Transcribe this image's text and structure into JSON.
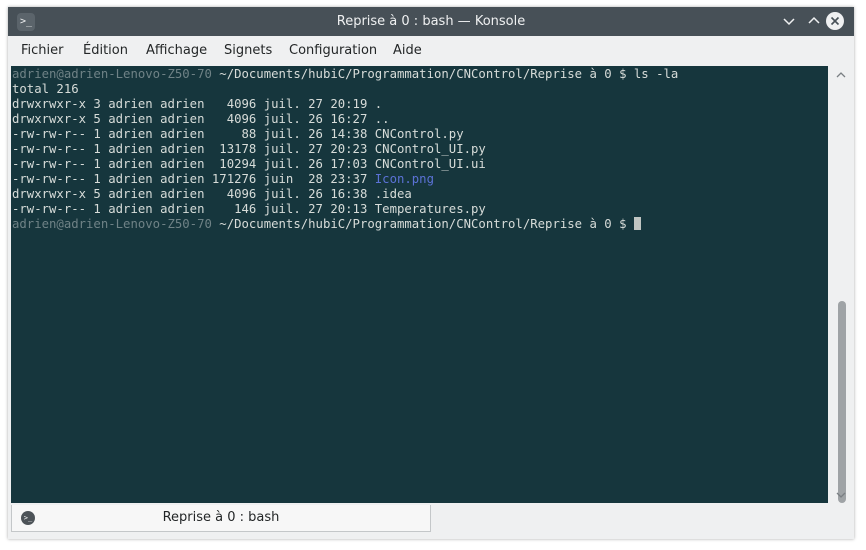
{
  "window": {
    "title": "Reprise à 0 : bash — Konsole",
    "app_icon": "terminal-icon",
    "app_icon_glyph": ">_",
    "buttons": {
      "minimize": "chevron-down-icon",
      "maximize": "chevron-up-icon",
      "close": "close-icon"
    }
  },
  "menu": [
    "Fichier",
    "Édition",
    "Affichage",
    "Signets",
    "Configuration",
    "Aide"
  ],
  "terminal": {
    "prompt": "adrien@adrien-Lenovo-Z50-70",
    "cwd": " ~/Documents/hubiC/Programmation/CNControl/Reprise à 0 $ ",
    "command": "ls -la",
    "total": "total 216",
    "entries": [
      {
        "meta": "drwxrwxr-x 3 adrien adrien   4096 juil. 27 20:19 ",
        "name": ".",
        "is_link": false
      },
      {
        "meta": "drwxrwxr-x 5 adrien adrien   4096 juil. 26 16:27 ",
        "name": "..",
        "is_link": false
      },
      {
        "meta": "-rw-rw-r-- 1 adrien adrien     88 juil. 26 14:38 ",
        "name": "CNControl.py",
        "is_link": false
      },
      {
        "meta": "-rw-rw-r-- 1 adrien adrien  13178 juil. 27 20:23 ",
        "name": "CNControl_UI.py",
        "is_link": false
      },
      {
        "meta": "-rw-rw-r-- 1 adrien adrien  10294 juil. 26 17:03 ",
        "name": "CNControl_UI.ui",
        "is_link": false
      },
      {
        "meta": "-rw-rw-r-- 1 adrien adrien 171276 juin  28 23:37 ",
        "name": "Icon.png",
        "is_link": true
      },
      {
        "meta": "drwxrwxr-x 5 adrien adrien   4096 juil. 26 16:38 ",
        "name": ".idea",
        "is_link": false
      },
      {
        "meta": "-rw-rw-r-- 1 adrien adrien    146 juil. 27 20:13 ",
        "name": "Temperatures.py",
        "is_link": false
      }
    ],
    "colors": {
      "background": "#16363d",
      "text": "#d7dcd9",
      "prompt": "#6f8286",
      "image_file": "#5b72d6"
    }
  },
  "tab": {
    "label": "Reprise à 0 : bash",
    "icon": "terminal-tab-icon",
    "icon_glyph": ">_"
  },
  "scrollbar": {
    "up_icon": "scroll-up-icon",
    "down_icon": "scroll-down-icon",
    "up_glyph": "▲",
    "down_glyph": "▼"
  }
}
